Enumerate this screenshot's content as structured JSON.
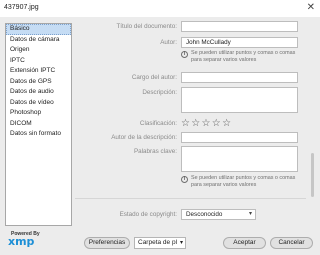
{
  "window": {
    "title": "437907.jpg",
    "close": "✕"
  },
  "sidebar": {
    "items": [
      {
        "label": "Básico"
      },
      {
        "label": "Datos de cámara"
      },
      {
        "label": "Origen"
      },
      {
        "label": "IPTC"
      },
      {
        "label": "Extensión IPTC"
      },
      {
        "label": "Datos de GPS"
      },
      {
        "label": "Datos de audio"
      },
      {
        "label": "Datos de vídeo"
      },
      {
        "label": "Photoshop"
      },
      {
        "label": "DICOM"
      },
      {
        "label": "Datos sin formato"
      }
    ]
  },
  "form": {
    "doc_title_label": "Título del documento:",
    "doc_title_value": "",
    "author_label": "Autor:",
    "author_value": "John McCullady",
    "author_hint": "Se pueden utilizar puntos y comas o comas para separar varios valores",
    "author_role_label": "Cargo del autor:",
    "author_role_value": "",
    "description_label": "Descripción:",
    "description_value": "",
    "rating_label": "Clasificación:",
    "rating_stars": 5,
    "rating_value": 0,
    "desc_author_label": "Autor de la descripción:",
    "desc_author_value": "",
    "keywords_label": "Palabras clave:",
    "keywords_value": "",
    "keywords_hint": "Se pueden utilizar puntos y comas o comas para separar varios valores",
    "copyright_label": "Estado de copyright:",
    "copyright_value": "Desconocido"
  },
  "footer": {
    "powered_by": "Powered By",
    "xmp_logo": "xmp",
    "prefs_button": "Preferencias",
    "folder_select": "Carpeta de pl",
    "accept_button": "Aceptar",
    "cancel_button": "Cancelar"
  },
  "icons": {
    "info": "info-icon",
    "star": "star-icon",
    "chevron": "chevron-down-icon",
    "close": "close-icon"
  },
  "colors": {
    "selection": "#c5dcf4",
    "xmp_blue": "#1d8fd6",
    "background": "#ececec"
  }
}
